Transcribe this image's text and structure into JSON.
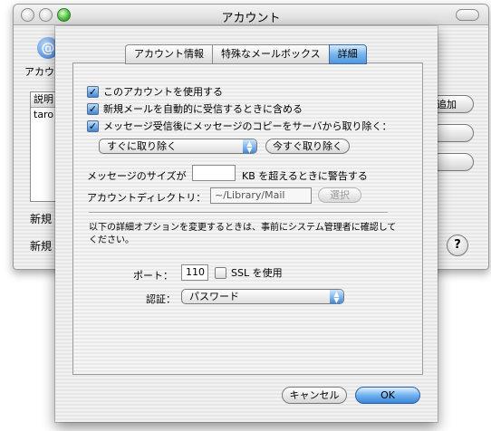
{
  "window": {
    "title": "アカウント"
  },
  "background": {
    "icon_letter": "@",
    "icon_label": "アカウ",
    "list_header": "説明",
    "list_row": "taro",
    "add_button": "追加",
    "new_label_1": "新規",
    "new_label_2": "新規",
    "help_glyph": "?"
  },
  "tabs": [
    {
      "label": "アカウント情報",
      "active": false
    },
    {
      "label": "特殊なメールボックス",
      "active": false
    },
    {
      "label": "詳細",
      "active": true
    }
  ],
  "options": {
    "use_account": {
      "label": "このアカウントを使用する",
      "checked": true
    },
    "include_auto_check": {
      "label": "新規メールを自動的に受信するときに含める",
      "checked": true
    },
    "remove_after_download": {
      "label": "メッセージ受信後にメッセージのコピーをサーバから取り除く：",
      "checked": true
    }
  },
  "remove_popup": {
    "value": "すぐに取り除く"
  },
  "remove_now_button": "今すぐ取り除く",
  "size_warning": {
    "prefix": "メッセージのサイズが",
    "value": "",
    "suffix": "KB を超えるときに警告する"
  },
  "account_directory": {
    "label": "アカウントディレクトリ：",
    "value": "~/Library/Mail",
    "choose_button": "選択"
  },
  "admin_note": "以下の詳細オプションを変更するときは、事前にシステム管理者に確認してください。",
  "port": {
    "label": "ポート：",
    "value": "110"
  },
  "ssl": {
    "label": "SSL を使用",
    "checked": false
  },
  "auth": {
    "label": "認証：",
    "value": "パスワード"
  },
  "buttons": {
    "cancel": "キャンセル",
    "ok": "OK"
  }
}
